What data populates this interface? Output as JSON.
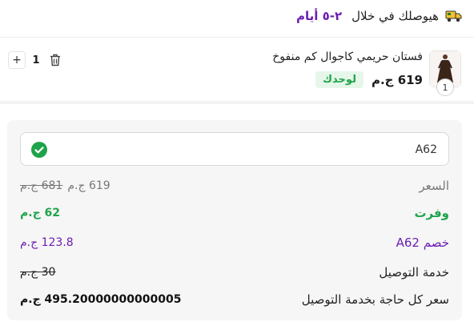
{
  "delivery": {
    "text": "هيوصلك في خلال",
    "days": "٢-٥ أيام",
    "icon": "truck-icon"
  },
  "product": {
    "name": "فستان حريمي كاجوال كم منفوخ",
    "price": "619 ج.م",
    "badge": "لوحدك",
    "thumb_qty": "1",
    "quantity": "1",
    "minus_icon": "trash-icon",
    "plus_label": "+"
  },
  "coupon": {
    "value": "A62",
    "status_icon": "check-circle-icon",
    "status_color": "#1fa34a"
  },
  "summary": {
    "price_label": "السعر",
    "price_old": "681 ج.م",
    "price_new": "619 ج.م",
    "saved_label": "وفرت",
    "saved_value": "62 ج.م",
    "discount_label": "خصم A62",
    "discount_value": "123.8 ج.م",
    "shipping_label": "خدمة التوصيل",
    "shipping_value": "30 ج.م",
    "total_label": "سعر كل حاجة بخدمة التوصيل",
    "total_value": "495.20000000000005 ج.م"
  },
  "colors": {
    "accent_purple": "#6b1fb1",
    "green": "#1fa34a",
    "muted": "#777777"
  }
}
